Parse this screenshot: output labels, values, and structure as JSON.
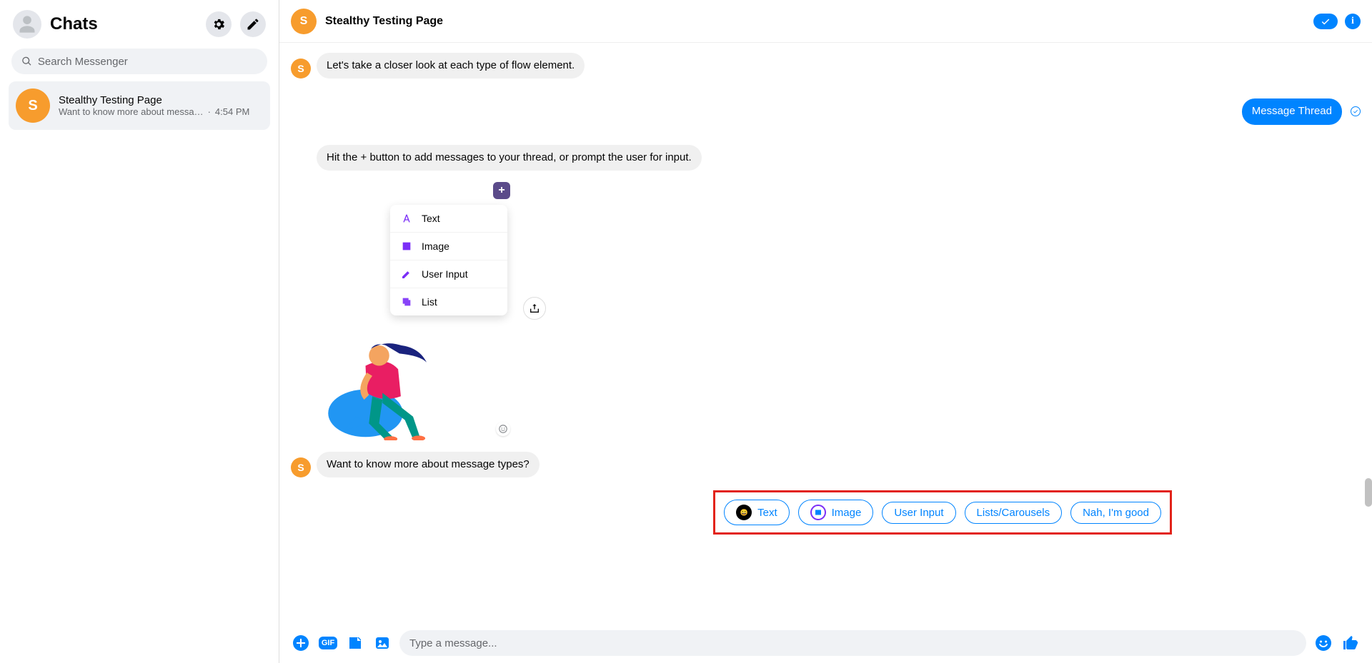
{
  "sidebar": {
    "title": "Chats",
    "search_placeholder": "Search Messenger",
    "chat": {
      "avatar_letter": "S",
      "name": "Stealthy Testing Page",
      "snippet": "Want to know more about messa…",
      "time": "4:54 PM"
    }
  },
  "header": {
    "avatar_letter": "S",
    "title": "Stealthy Testing Page",
    "info_glyph": "i"
  },
  "messages": {
    "msg1": {
      "avatar_letter": "S",
      "text": "Let's take a closer look at each type of flow element."
    },
    "msg2": {
      "text": "Message Thread"
    },
    "msg3": {
      "text": "Hit the + button to add messages to your thread, or prompt the user for input."
    },
    "msg4_dropdown": {
      "items": [
        {
          "label": "Text"
        },
        {
          "label": "Image"
        },
        {
          "label": "User Input"
        },
        {
          "label": "List"
        }
      ],
      "plus": "+"
    },
    "msg5": {
      "avatar_letter": "S",
      "text": "Want to know more about message types?"
    }
  },
  "quick_replies": [
    {
      "label": "Text",
      "icon": "emoji-dark"
    },
    {
      "label": "Image",
      "icon": "gallery"
    },
    {
      "label": "User Input",
      "icon": "none"
    },
    {
      "label": "Lists/Carousels",
      "icon": "none"
    },
    {
      "label": "Nah, I'm good",
      "icon": "none"
    }
  ],
  "composer": {
    "placeholder": "Type a message...",
    "gif_label": "GIF"
  }
}
